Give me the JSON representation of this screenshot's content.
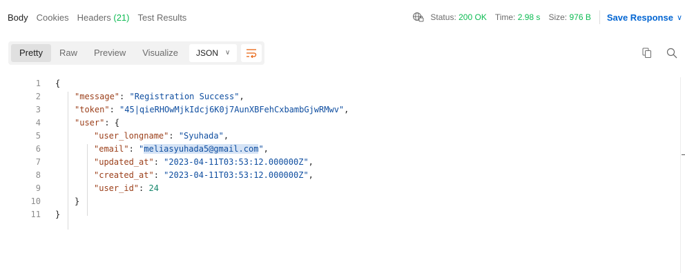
{
  "tabs": [
    {
      "label": "Body"
    },
    {
      "label": "Cookies"
    },
    {
      "label": "Headers",
      "count": "(21)"
    },
    {
      "label": "Test Results"
    }
  ],
  "status": {
    "status_label": "Status:",
    "status_value": "200 OK",
    "time_label": "Time:",
    "time_value": "2.98 s",
    "size_label": "Size:",
    "size_value": "976 B",
    "save_label": "Save Response",
    "status_color": "#0cbb52"
  },
  "view_modes": [
    "Pretty",
    "Raw",
    "Preview",
    "Visualize"
  ],
  "format": "JSON",
  "icons": {
    "network": "globe-lock-icon",
    "wrap": "word-wrap-icon",
    "copy": "copy-icon",
    "search": "search-icon"
  },
  "code_lines": [
    {
      "n": "1",
      "tokens": [
        {
          "t": "p",
          "v": "{"
        }
      ]
    },
    {
      "n": "2",
      "tokens": [
        {
          "t": "k",
          "v": "\"message\""
        },
        {
          "t": "p",
          "v": ": "
        },
        {
          "t": "s",
          "v": "\"Registration Success\""
        },
        {
          "t": "p",
          "v": ","
        }
      ]
    },
    {
      "n": "3",
      "tokens": [
        {
          "t": "k",
          "v": "\"token\""
        },
        {
          "t": "p",
          "v": ": "
        },
        {
          "t": "s",
          "v": "\"45|qieRHOwMjkIdcj6K0j7AunXBFehCxbambGjwRMwv\""
        },
        {
          "t": "p",
          "v": ","
        }
      ]
    },
    {
      "n": "4",
      "tokens": [
        {
          "t": "k",
          "v": "\"user\""
        },
        {
          "t": "p",
          "v": ": {"
        }
      ]
    },
    {
      "n": "5",
      "tokens": [
        {
          "t": "k",
          "v": "\"user_longname\""
        },
        {
          "t": "p",
          "v": ": "
        },
        {
          "t": "s",
          "v": "\"Syuhada\""
        },
        {
          "t": "p",
          "v": ","
        }
      ]
    },
    {
      "n": "6",
      "tokens": [
        {
          "t": "k",
          "v": "\"email\""
        },
        {
          "t": "p",
          "v": ": "
        },
        {
          "t": "s",
          "v": "\""
        },
        {
          "t": "hl",
          "v": "meliasyuhada5@gmail.com"
        },
        {
          "t": "s",
          "v": "\""
        },
        {
          "t": "p",
          "v": ","
        }
      ]
    },
    {
      "n": "7",
      "tokens": [
        {
          "t": "k",
          "v": "\"updated_at\""
        },
        {
          "t": "p",
          "v": ": "
        },
        {
          "t": "s",
          "v": "\"2023-04-11T03:53:12.000000Z\""
        },
        {
          "t": "p",
          "v": ","
        }
      ]
    },
    {
      "n": "8",
      "tokens": [
        {
          "t": "k",
          "v": "\"created_at\""
        },
        {
          "t": "p",
          "v": ": "
        },
        {
          "t": "s",
          "v": "\"2023-04-11T03:53:12.000000Z\""
        },
        {
          "t": "p",
          "v": ","
        }
      ]
    },
    {
      "n": "9",
      "tokens": [
        {
          "t": "k",
          "v": "\"user_id\""
        },
        {
          "t": "p",
          "v": ": "
        },
        {
          "t": "n",
          "v": "24"
        }
      ]
    },
    {
      "n": "10",
      "tokens": [
        {
          "t": "p",
          "v": "}"
        }
      ]
    },
    {
      "n": "11",
      "tokens": [
        {
          "t": "p",
          "v": "}"
        }
      ]
    }
  ]
}
